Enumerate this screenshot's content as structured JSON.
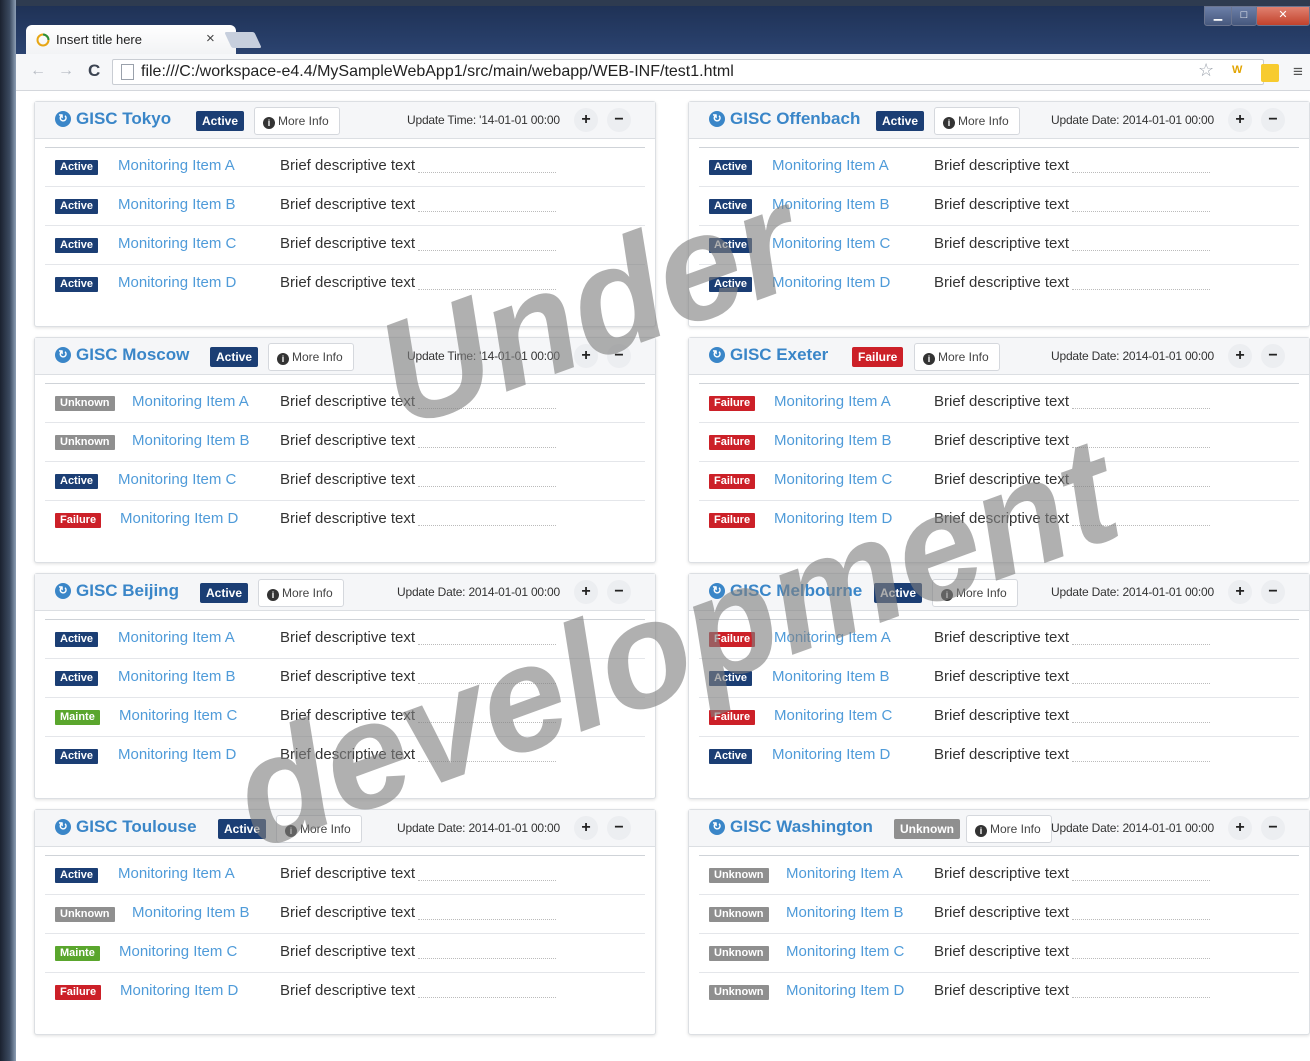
{
  "browser": {
    "tab_title": "Insert title here",
    "tab_close": "×",
    "url": "file:///C:/workspace-e4.4/MySampleWebApp1/src/main/webapp/WEB-INF/test1.html",
    "back": "←",
    "forward": "→",
    "reload": "C",
    "star": "☆",
    "ext_w": "W",
    "menu": "≡"
  },
  "colors": {
    "active": "#1b3e74",
    "failure": "#cc2028",
    "unknown": "#8f8f8f",
    "mainte": "#5aa62d",
    "link": "#4f9bd9"
  },
  "panels": [
    {
      "title": "GISC Tokyo",
      "status": "Active",
      "more_info": "More Info",
      "update": "Update Time: '14-01-01 00:00",
      "items": [
        {
          "status": "Active",
          "name": "Monitoring Item A",
          "desc": "Brief descriptive text"
        },
        {
          "status": "Active",
          "name": "Monitoring Item B",
          "desc": "Brief descriptive text"
        },
        {
          "status": "Active",
          "name": "Monitoring Item C",
          "desc": "Brief descriptive text"
        },
        {
          "status": "Active",
          "name": "Monitoring Item D",
          "desc": "Brief descriptive text"
        }
      ]
    },
    {
      "title": "GISC Offenbach",
      "status": "Active",
      "more_info": "More Info",
      "update": "Update Date: 2014-01-01 00:00",
      "items": [
        {
          "status": "Active",
          "name": "Monitoring Item A",
          "desc": "Brief descriptive text"
        },
        {
          "status": "Active",
          "name": "Monitoring Item B",
          "desc": "Brief descriptive text"
        },
        {
          "status": "Active",
          "name": "Monitoring Item C",
          "desc": "Brief descriptive text"
        },
        {
          "status": "Active",
          "name": "Monitoring Item D",
          "desc": "Brief descriptive text"
        }
      ]
    },
    {
      "title": "GISC Moscow",
      "status": "Active",
      "more_info": "More Info",
      "update": "Update Time: '14-01-01 00:00",
      "items": [
        {
          "status": "Unknown",
          "name": "Monitoring Item A",
          "desc": "Brief descriptive text"
        },
        {
          "status": "Unknown",
          "name": "Monitoring Item B",
          "desc": "Brief descriptive text"
        },
        {
          "status": "Active",
          "name": "Monitoring Item C",
          "desc": "Brief descriptive text"
        },
        {
          "status": "Failure",
          "name": "Monitoring Item D",
          "desc": "Brief descriptive text"
        }
      ]
    },
    {
      "title": "GISC Exeter",
      "status": "Failure",
      "more_info": "More Info",
      "update": "Update Date: 2014-01-01 00:00",
      "items": [
        {
          "status": "Failure",
          "name": "Monitoring Item A",
          "desc": "Brief descriptive text"
        },
        {
          "status": "Failure",
          "name": "Monitoring Item B",
          "desc": "Brief descriptive text"
        },
        {
          "status": "Failure",
          "name": "Monitoring Item C",
          "desc": "Brief descriptive text"
        },
        {
          "status": "Failure",
          "name": "Monitoring Item D",
          "desc": "Brief descriptive text"
        }
      ]
    },
    {
      "title": "GISC Beijing",
      "status": "Active",
      "more_info": "More Info",
      "update": "Update Date: 2014-01-01 00:00",
      "items": [
        {
          "status": "Active",
          "name": "Monitoring Item A",
          "desc": "Brief descriptive text"
        },
        {
          "status": "Active",
          "name": "Monitoring Item B",
          "desc": "Brief descriptive text"
        },
        {
          "status": "Mainte",
          "name": "Monitoring Item C",
          "desc": "Brief descriptive text"
        },
        {
          "status": "Active",
          "name": "Monitoring Item D",
          "desc": "Brief descriptive text"
        }
      ]
    },
    {
      "title": "GISC Melbourne",
      "status": "Active",
      "more_info": "More Info",
      "update": "Update Date: 2014-01-01 00:00",
      "items": [
        {
          "status": "Failure",
          "name": "Monitoring Item A",
          "desc": "Brief descriptive text"
        },
        {
          "status": "Active",
          "name": "Monitoring Item B",
          "desc": "Brief descriptive text"
        },
        {
          "status": "Failure",
          "name": "Monitoring Item C",
          "desc": "Brief descriptive text"
        },
        {
          "status": "Active",
          "name": "Monitoring Item D",
          "desc": "Brief descriptive text"
        }
      ]
    },
    {
      "title": "GISC Toulouse",
      "status": "Active",
      "more_info": "More Info",
      "update": "Update Date: 2014-01-01 00:00",
      "items": [
        {
          "status": "Active",
          "name": "Monitoring Item A",
          "desc": "Brief descriptive text"
        },
        {
          "status": "Unknown",
          "name": "Monitoring Item B",
          "desc": "Brief descriptive text"
        },
        {
          "status": "Mainte",
          "name": "Monitoring Item C",
          "desc": "Brief descriptive text"
        },
        {
          "status": "Failure",
          "name": "Monitoring Item D",
          "desc": "Brief descriptive text"
        }
      ]
    },
    {
      "title": "GISC Washington",
      "status": "Unknown",
      "more_info": "More Info",
      "update": "Update Date: 2014-01-01 00:00",
      "items": [
        {
          "status": "Unknown",
          "name": "Monitoring Item A",
          "desc": "Brief descriptive text"
        },
        {
          "status": "Unknown",
          "name": "Monitoring Item B",
          "desc": "Brief descriptive text"
        },
        {
          "status": "Unknown",
          "name": "Monitoring Item C",
          "desc": "Brief descriptive text"
        },
        {
          "status": "Unknown",
          "name": "Monitoring Item D",
          "desc": "Brief descriptive text"
        }
      ]
    }
  ],
  "panel_controls": {
    "plus": "+",
    "minus": "−",
    "globe": "↻",
    "info": "i"
  },
  "watermark": {
    "line1": "Under",
    "line2": "development"
  }
}
